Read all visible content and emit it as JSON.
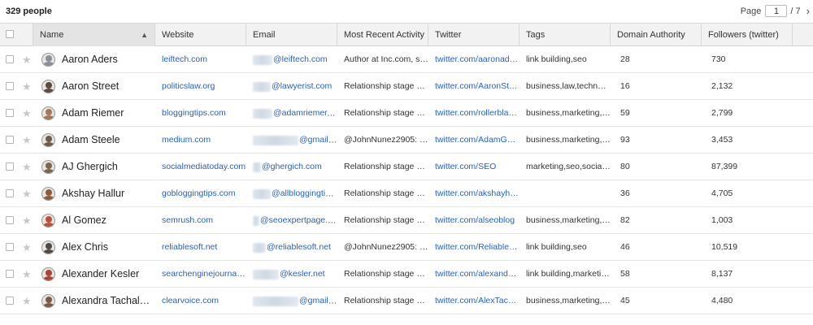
{
  "summary": {
    "count": "329 people"
  },
  "pager": {
    "label": "Page",
    "current": "1",
    "total": "/ 7",
    "next_icon": "chevron-right"
  },
  "columns": {
    "name": "Name",
    "website": "Website",
    "email": "Email",
    "activity": "Most Recent Activity",
    "twitter": "Twitter",
    "tags": "Tags",
    "authority": "Domain Authority",
    "followers": "Followers (twitter)"
  },
  "colors": {
    "link": "#2a62b3",
    "header_bg": "#f2f2f2",
    "sorted_header_bg": "#e4e4e4"
  },
  "rows": [
    {
      "name": "Aaron Aders",
      "website": "leiftech.com",
      "email": "@leiftech.com",
      "activity": "Author at Inc.com, sear...",
      "twitter": "twitter.com/aaronaders",
      "tags": "link building,seo",
      "authority": "28",
      "followers": "730",
      "avatar": "#8a8f98"
    },
    {
      "name": "Aaron Street",
      "website": "politicslaw.org",
      "email": "@lawyerist.com",
      "activity": "Relationship stage cha...",
      "twitter": "twitter.com/AaronStreet",
      "tags": "business,law,technology",
      "authority": "16",
      "followers": "2,132",
      "avatar": "#5b4a3f"
    },
    {
      "name": "Adam Riemer",
      "website": "bloggingtips.com",
      "email": "@adamriemer.me",
      "activity": "Relationship stage cha...",
      "twitter": "twitter.com/rollerblader",
      "tags": "business,marketing,seo",
      "authority": "59",
      "followers": "2,799",
      "avatar": "#a0785a"
    },
    {
      "name": "Adam Steele",
      "website": "medium.com",
      "email": "@gmail.c...",
      "activity": "@JohnNunez2905: @A...",
      "twitter": "twitter.com/AdamGSte...",
      "tags": "business,marketing,seo",
      "authority": "93",
      "followers": "3,453",
      "avatar": "#6e5b4b"
    },
    {
      "name": "AJ Ghergich",
      "website": "socialmediatoday.com",
      "email": "@ghergich.com",
      "activity": "Relationship stage cha...",
      "twitter": "twitter.com/SEO",
      "tags": "marketing,seo,social m...",
      "authority": "80",
      "followers": "87,399",
      "avatar": "#7b6652"
    },
    {
      "name": "Akshay Hallur",
      "website": "gobloggingtips.com",
      "email": "@allbloggingtips...",
      "activity": "Relationship stage cha...",
      "twitter": "twitter.com/akshayhallur",
      "tags": "",
      "authority": "36",
      "followers": "4,705",
      "avatar": "#8c5a3c"
    },
    {
      "name": "Al Gomez",
      "website": "semrush.com",
      "email": "@seoexpertpage.com",
      "activity": "Relationship stage cha...",
      "twitter": "twitter.com/alseoblog",
      "tags": "business,marketing,soc...",
      "authority": "82",
      "followers": "1,003",
      "avatar": "#b5533c"
    },
    {
      "name": "Alex Chris",
      "website": "reliablesoft.net",
      "email": "@reliablesoft.net",
      "activity": "@JohnNunez2905: @R...",
      "twitter": "twitter.com/Reliablesoft...",
      "tags": "link building,seo",
      "authority": "46",
      "followers": "10,519",
      "avatar": "#4f4a45"
    },
    {
      "name": "Alexander Kesler",
      "website": "searchenginejournal.stl...",
      "email": "@kesler.net",
      "activity": "Relationship stage cha...",
      "twitter": "twitter.com/alexanderk...",
      "tags": "link building,marketing,...",
      "authority": "58",
      "followers": "8,137",
      "avatar": "#a8453a"
    },
    {
      "name": "Alexandra Tachalova",
      "website": "clearvoice.com",
      "email": "@gmail.c...",
      "activity": "Relationship stage cha...",
      "twitter": "twitter.com/AlexTachal...",
      "tags": "business,marketing,seo",
      "authority": "45",
      "followers": "4,480",
      "avatar": "#7a5a4a"
    }
  ]
}
